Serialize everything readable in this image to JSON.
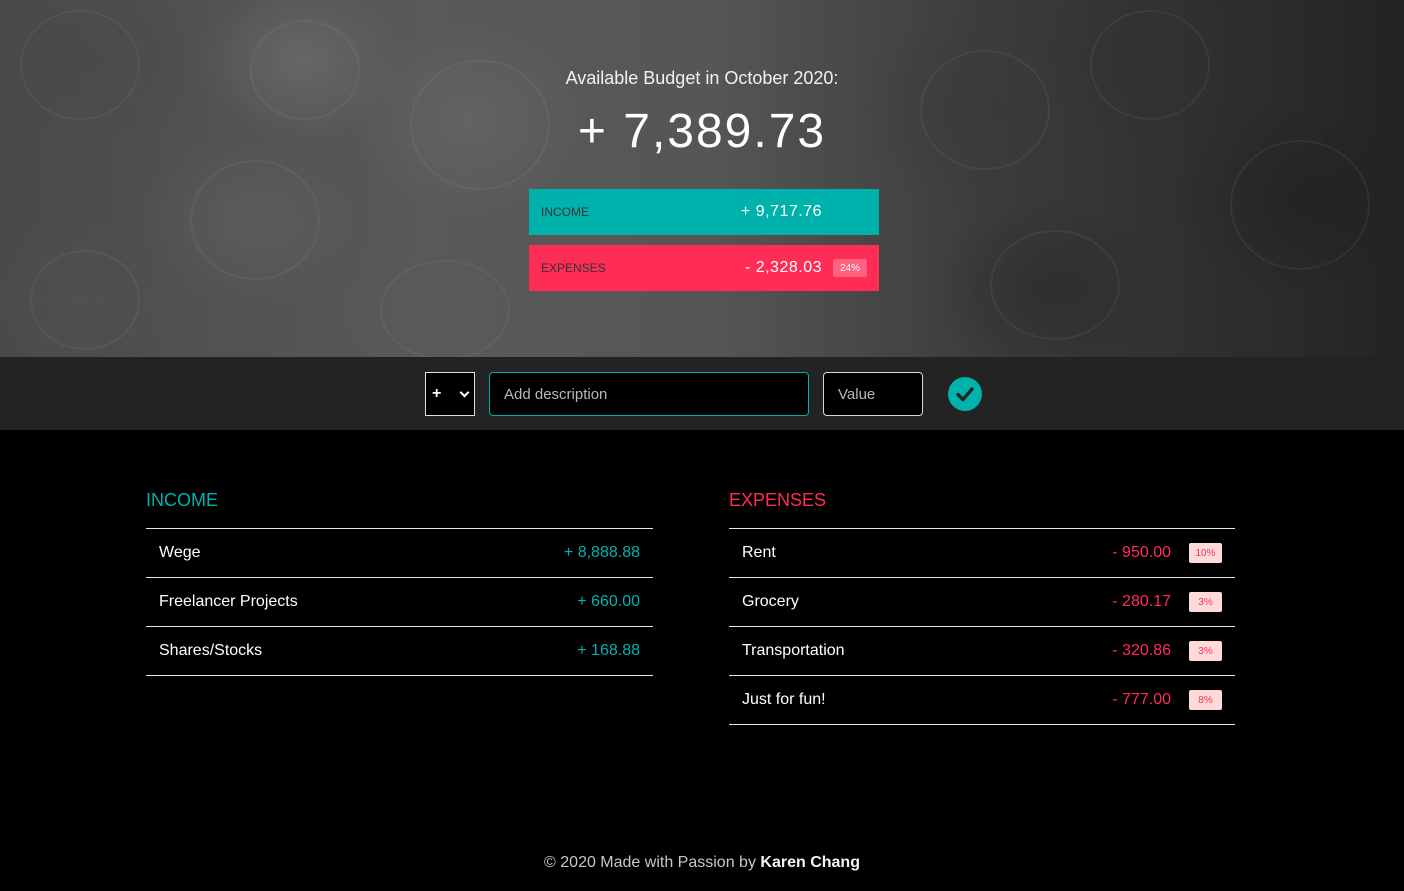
{
  "header": {
    "title": "Available Budget in October 2020:",
    "budget_value": "+ 7,389.73",
    "income": {
      "label": "INCOME",
      "value": "+ 9,717.76"
    },
    "expenses": {
      "label": "EXPENSES",
      "value": "- 2,328.03",
      "percent": "24%"
    }
  },
  "add_form": {
    "type_value": "+",
    "description_placeholder": "Add description",
    "value_placeholder": "Value",
    "submit_icon": "checkmark-icon"
  },
  "income": {
    "title": "INCOME",
    "items": [
      {
        "description": "Wege",
        "value": "+ 8,888.88"
      },
      {
        "description": "Freelancer Projects",
        "value": "+ 660.00"
      },
      {
        "description": "Shares/Stocks",
        "value": "+ 168.88"
      }
    ]
  },
  "expenses": {
    "title": "EXPENSES",
    "items": [
      {
        "description": "Rent",
        "value": "- 950.00",
        "percent": "10%"
      },
      {
        "description": "Grocery",
        "value": "- 280.17",
        "percent": "3%"
      },
      {
        "description": "Transportation",
        "value": "- 320.86",
        "percent": "3%"
      },
      {
        "description": "Just for fun!",
        "value": "- 777.00",
        "percent": "8%"
      }
    ]
  },
  "footer": {
    "text": "© 2020 Made with Passion by",
    "author": "Karen Chang"
  },
  "colors": {
    "income": "#00b2ac",
    "expense": "#ff2d55",
    "bar_background": "#232323"
  }
}
